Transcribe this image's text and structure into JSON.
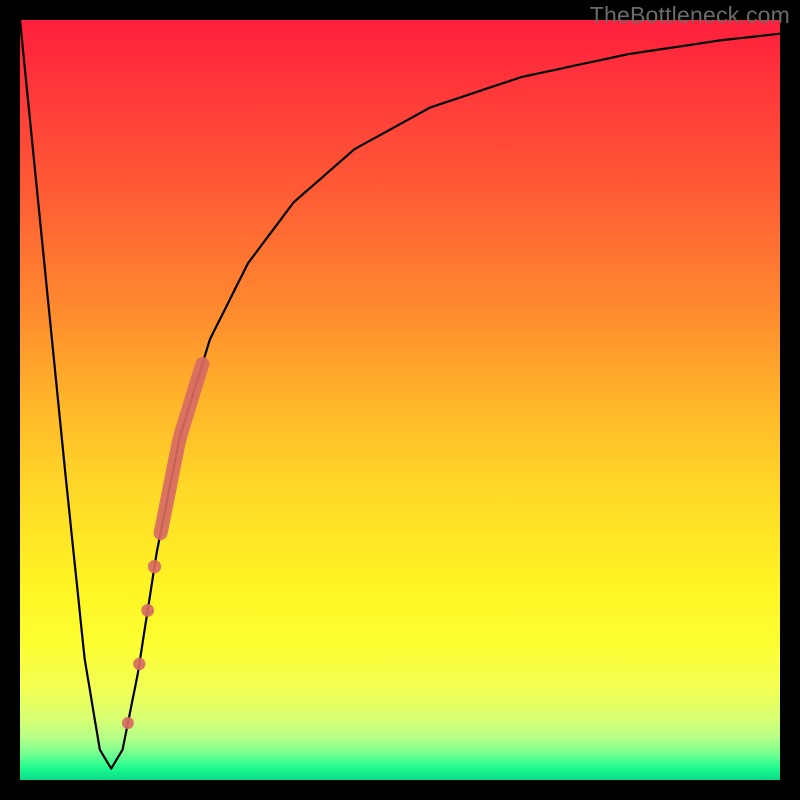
{
  "watermark": "TheBottleneck.com",
  "chart_data": {
    "type": "line",
    "title": "",
    "xlabel": "",
    "ylabel": "",
    "xlim": [
      0,
      100
    ],
    "ylim": [
      0,
      100
    ],
    "series": [
      {
        "name": "bottleneck-curve",
        "x": [
          0,
          3,
          6,
          8.5,
          10.5,
          12,
          13.5,
          15.5,
          18,
          21,
          25,
          30,
          36,
          44,
          54,
          66,
          80,
          92,
          100
        ],
        "y": [
          100,
          70,
          40,
          16,
          4,
          1.5,
          4,
          14,
          30,
          45,
          58,
          68,
          76,
          83,
          88.5,
          92.5,
          95.5,
          97.3,
          98.2
        ]
      }
    ],
    "highlight_segment": {
      "series": "bottleneck-curve",
      "x_start": 18.5,
      "x_end": 24.0,
      "note": "thick salmon segment along rising edge"
    },
    "dots": {
      "series": "bottleneck-curve",
      "x": [
        14.2,
        15.7,
        16.8,
        17.7
      ],
      "note": "small salmon dots along rising edge below highlight"
    },
    "background_gradient": {
      "direction": "top-to-bottom",
      "stops": [
        {
          "pos": 0.0,
          "color": "#ff1e3c"
        },
        {
          "pos": 0.5,
          "color": "#ffb42a"
        },
        {
          "pos": 0.82,
          "color": "#fdff30"
        },
        {
          "pos": 0.96,
          "color": "#76ff8f"
        },
        {
          "pos": 1.0,
          "color": "#0bd988"
        }
      ]
    }
  }
}
